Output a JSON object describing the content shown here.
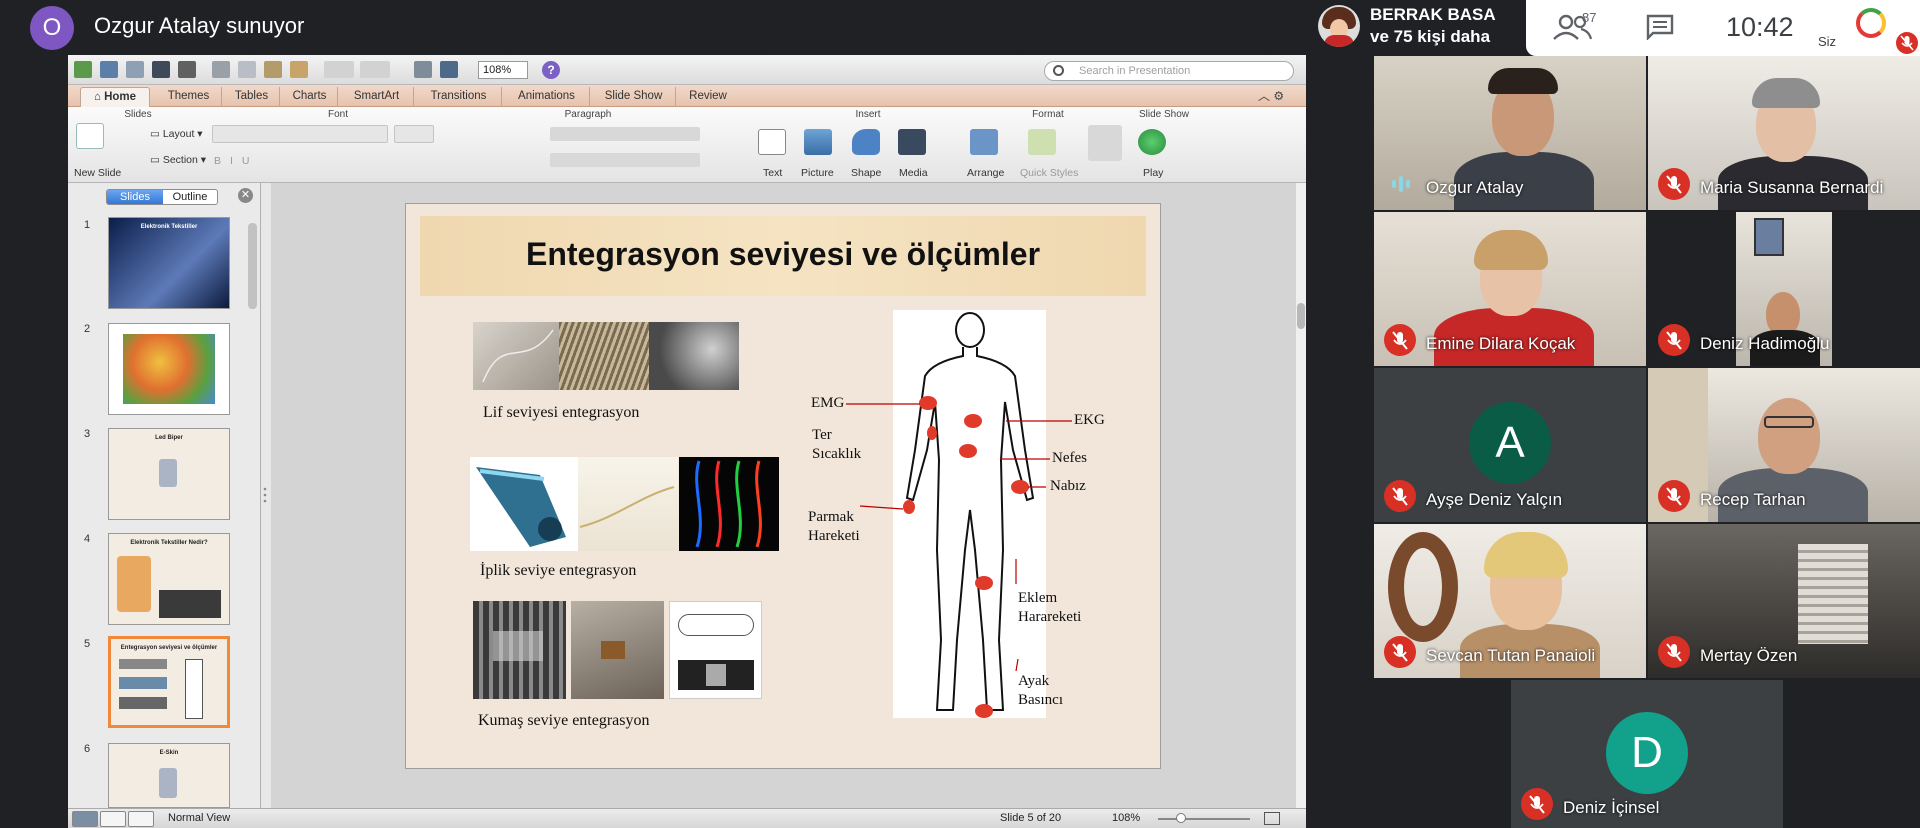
{
  "presenter": {
    "avatar_letter": "O",
    "title": "Ozgur Atalay sunuyor"
  },
  "viewers": {
    "line1": "BERRAK BASA",
    "line2": "ve 75 kişi daha"
  },
  "status": {
    "participants_count": "87",
    "time": "10:42",
    "self_label": "Siz"
  },
  "keynote": {
    "zoom": "108%",
    "search_placeholder": "Search in Presentation",
    "tabs": [
      "Home",
      "Themes",
      "Tables",
      "Charts",
      "SmartArt",
      "Transitions",
      "Animations",
      "Slide Show",
      "Review"
    ],
    "groups": {
      "slides": "Slides",
      "font": "Font",
      "paragraph": "Paragraph",
      "insert": "Insert",
      "format": "Format",
      "slide_show": "Slide Show"
    },
    "ribbon": {
      "new_slide": "New Slide",
      "layout": "Layout",
      "section": "Section",
      "text": "Text",
      "picture": "Picture",
      "shape": "Shape",
      "media": "Media",
      "arrange": "Arrange",
      "quick_styles": "Quick Styles",
      "play": "Play"
    },
    "pane_tabs": {
      "slides": "Slides",
      "outline": "Outline"
    },
    "thumbnails": [
      {
        "num": "1",
        "title": "Elektronik Tekstiller"
      },
      {
        "num": "2",
        "title": ""
      },
      {
        "num": "3",
        "title": "Led Biper"
      },
      {
        "num": "4",
        "title": "Elektronik Tekstiller Nedir?"
      },
      {
        "num": "5",
        "title": "Entegrasyon seviyesi ve ölçümler"
      },
      {
        "num": "6",
        "title": "E-Skin"
      }
    ],
    "status": {
      "view": "Normal View",
      "slide_pos": "Slide 5 of 20",
      "zoom": "108%"
    }
  },
  "slide": {
    "title": "Entegrasyon seviyesi ve ölçümler",
    "captions": {
      "fiber": "Lif  seviyesi entegrasyon",
      "yarn": "İplik seviye entegrasyon",
      "fabric": "Kumaş seviye entegrasyon"
    },
    "body_labels": {
      "emg": "EMG",
      "ter": "Ter",
      "sicaklik": "Sıcaklık",
      "parmak": "Parmak",
      "hareketi": "Hareketi",
      "ekg": "EKG",
      "nefes": "Nefes",
      "nabiz": "Nabız",
      "eklem": "Eklem",
      "eklem_hareketi": "Harareketi",
      "ayak": "Ayak",
      "basinci": "Basıncı"
    }
  },
  "participants": [
    {
      "name": "Ozgur Atalay",
      "muted": false
    },
    {
      "name": "Maria Susanna Bernardi",
      "muted": true
    },
    {
      "name": "Emine Dilara Koçak",
      "muted": true
    },
    {
      "name": "Deniz Hadimoğlu",
      "muted": true
    },
    {
      "name": "Ayşe Deniz Yalçın",
      "muted": true,
      "avatar_letter": "A",
      "avatar_color": "#0b5c46"
    },
    {
      "name": "Recep Tarhan",
      "muted": true
    },
    {
      "name": "Sevcan Tutan Panaioli",
      "muted": true
    },
    {
      "name": "Mertay Özen",
      "muted": true
    },
    {
      "name": "Deniz İçinsel",
      "muted": true,
      "avatar_letter": "D",
      "avatar_color": "#12a18a"
    }
  ],
  "colors": {
    "mute_red": "#d93025",
    "thumb_selected": "#f08a3a",
    "presenter_avatar": "#7e57c2"
  }
}
